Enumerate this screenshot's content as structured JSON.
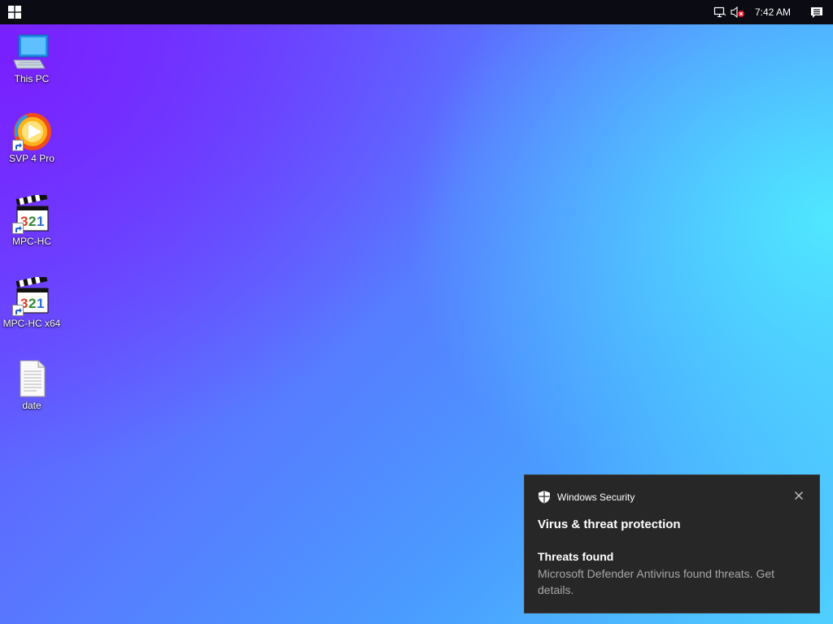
{
  "taskbar": {
    "clock": "7:42 AM",
    "icons": [
      "windows-start-icon",
      "network-icon",
      "volume-muted-icon",
      "action-center-icon"
    ]
  },
  "desktop": {
    "icons": [
      {
        "label": "This PC",
        "icon": "computer-icon"
      },
      {
        "label": "SVP 4 Pro",
        "icon": "svp-icon"
      },
      {
        "label": "MPC-HC",
        "icon": "mpc-hc-icon"
      },
      {
        "label": "MPC-HC x64",
        "icon": "mpc-hc-icon"
      },
      {
        "label": "date",
        "icon": "text-file-icon"
      }
    ]
  },
  "toast": {
    "app_name": "Windows Security",
    "title": "Virus & threat protection",
    "subtitle": "Threats found",
    "body": "Microsoft Defender Antivirus found threats. Get details."
  },
  "colors": {
    "taskbar_bg": "#0b0b14",
    "toast_bg": "#272727",
    "toast_secondary_text": "#a8a8a8",
    "mute_badge": "#e81123"
  }
}
